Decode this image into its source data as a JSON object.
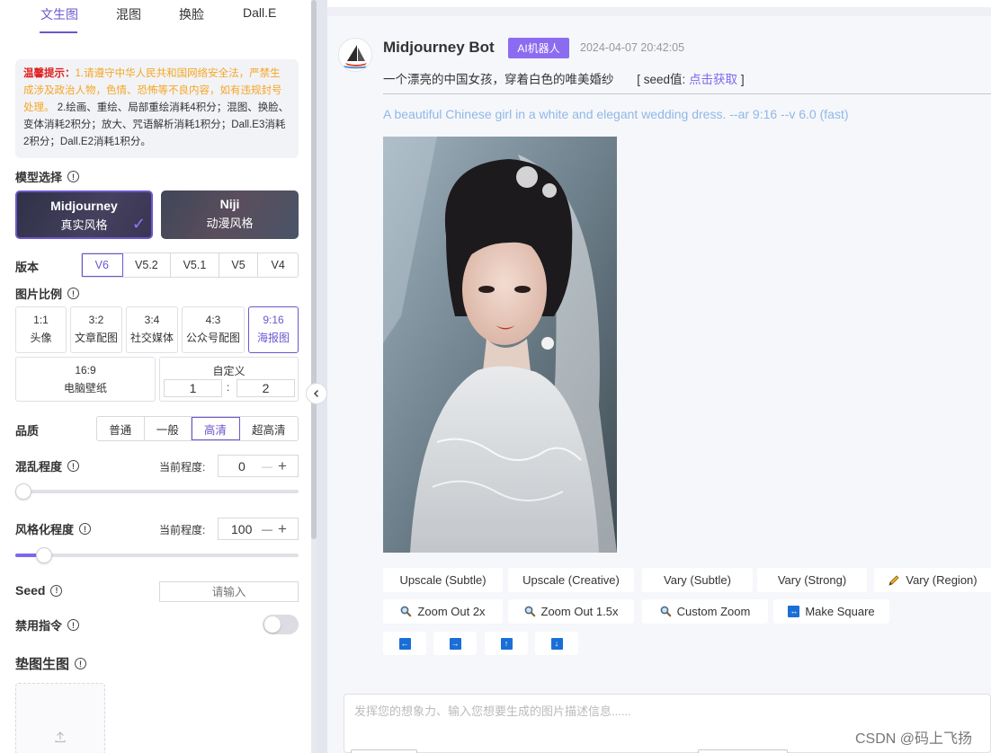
{
  "tabs": [
    {
      "label": "文生图",
      "active": true
    },
    {
      "label": "混图",
      "active": false
    },
    {
      "label": "换脸",
      "active": false
    },
    {
      "label": "Dall.E",
      "active": false
    }
  ],
  "notice": {
    "title": "温馨提示：",
    "warning": "1.请遵守中华人民共和国网络安全法，严禁生成涉及政治人物，色情、恐怖等不良内容，如有违规封号处理。",
    "info": "2.绘画、重绘、局部重绘消耗4积分；混图、换脸、变体消耗2积分；放大、咒语解析消耗1积分；Dall.E3消耗2积分；Dall.E2消耗1积分。"
  },
  "model": {
    "label": "模型选择",
    "options": [
      {
        "title": "Midjourney",
        "subtitle": "真实风格",
        "selected": true
      },
      {
        "title": "Niji",
        "subtitle": "动漫风格",
        "selected": false
      }
    ]
  },
  "version": {
    "label": "版本",
    "options": [
      "V6",
      "V5.2",
      "V5.1",
      "V5",
      "V4"
    ],
    "selected": "V6"
  },
  "ratio": {
    "label": "图片比例",
    "options": [
      {
        "ratio": "1:1",
        "name": "头像"
      },
      {
        "ratio": "3:2",
        "name": "文章配图"
      },
      {
        "ratio": "3:4",
        "name": "社交媒体"
      },
      {
        "ratio": "4:3",
        "name": "公众号配图"
      },
      {
        "ratio": "9:16",
        "name": "海报图"
      },
      {
        "ratio": "16:9",
        "name": "电脑壁纸"
      }
    ],
    "selected": "9:16",
    "custom": {
      "label": "自定义",
      "w": "1",
      "sep": ":",
      "h": "2"
    }
  },
  "quality": {
    "label": "品质",
    "options": [
      "普通",
      "一般",
      "高清",
      "超高清"
    ],
    "selected": "高清"
  },
  "chaos": {
    "label": "混乱程度",
    "current_label": "当前程度:",
    "value": "0",
    "minus": "—",
    "plus": "+",
    "level": 0.02
  },
  "stylize": {
    "label": "风格化程度",
    "current_label": "当前程度:",
    "value": "100",
    "minus": "—",
    "plus": "+",
    "level": 0.1
  },
  "seed": {
    "label": "Seed",
    "placeholder": "请输入"
  },
  "no_cmd": {
    "label": "禁用指令",
    "on": false
  },
  "pad_image": {
    "label": "垫图生图",
    "upload_icon": "upload-icon"
  },
  "message": {
    "bot_name": "Midjourney Bot",
    "badge": "AI机器人",
    "time": "2024-04-07 20:42:05",
    "prompt_cn": "一个漂亮的中国女孩，穿着白色的唯美婚纱",
    "seed_open": "[ seed值:",
    "seed_link": "点击获取",
    "seed_close": "]",
    "prompt_en": "A beautiful Chinese girl in a white and elegant wedding dress. --ar 9:16 --v 6.0  (fast)"
  },
  "actions_row1": [
    "Upscale (Subtle)",
    "Upscale (Creative)",
    "Vary (Subtle)",
    "Vary (Strong)",
    "Vary (Region)"
  ],
  "actions_row2": [
    "Zoom Out 2x",
    "Zoom Out 1.5x",
    "Custom Zoom",
    "Make Square"
  ],
  "arrows": [
    "left-arrow-icon",
    "right-arrow-icon",
    "up-arrow-icon",
    "down-arrow-icon"
  ],
  "input": {
    "placeholder": "发挥您的想象力、输入您想要生成的图片描述信息......"
  },
  "watermark": "CSDN @码上飞扬",
  "colors": {
    "accent": "#6e56cf",
    "badge": "#8b6cf0",
    "link": "#7b68ee",
    "en_prompt": "#8fb8e6",
    "warning_red": "#e02020",
    "warning_orange": "#f5a623"
  }
}
